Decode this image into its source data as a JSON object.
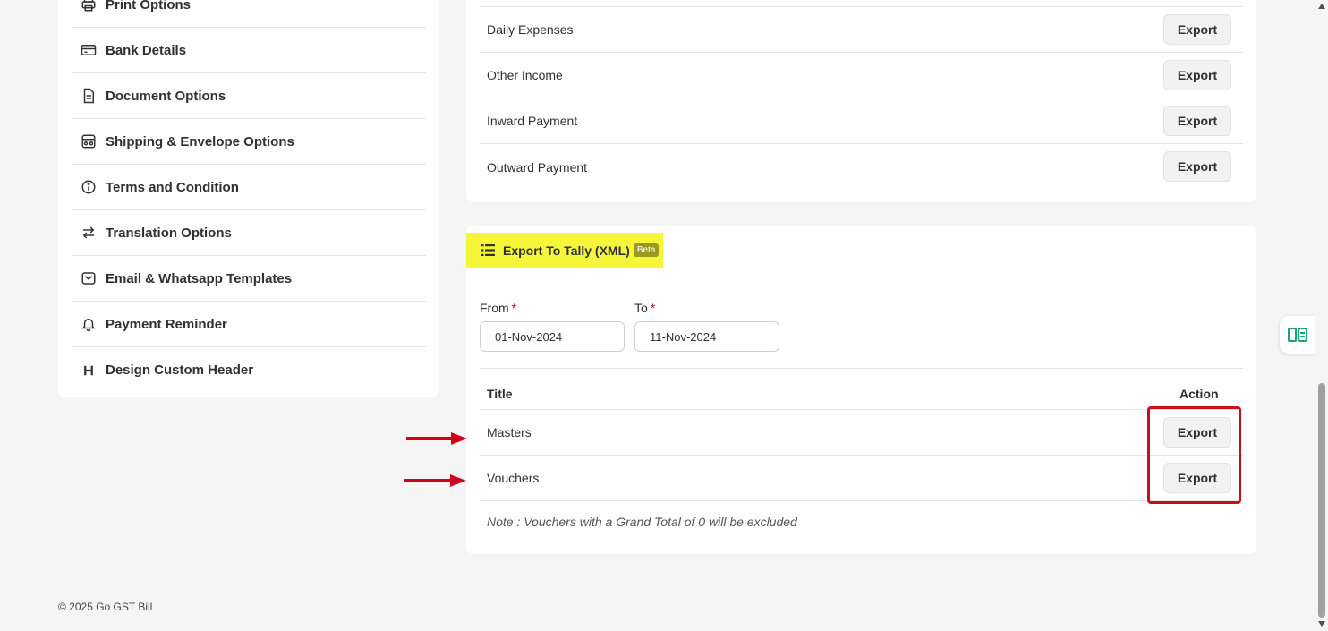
{
  "sidebar": {
    "items": [
      {
        "label": "Print Options",
        "icon": "printer-icon"
      },
      {
        "label": "Bank Details",
        "icon": "credit-card-icon"
      },
      {
        "label": "Document Options",
        "icon": "document-icon"
      },
      {
        "label": "Shipping & Envelope Options",
        "icon": "shipping-box-icon"
      },
      {
        "label": "Terms and Condition",
        "icon": "info-icon"
      },
      {
        "label": "Translation Options",
        "icon": "swap-arrows-icon"
      },
      {
        "label": "Email & Whatsapp Templates",
        "icon": "mail-icon"
      },
      {
        "label": "Payment Reminder",
        "icon": "bell-icon"
      },
      {
        "label": "Design Custom Header",
        "icon": "heading-icon"
      }
    ]
  },
  "export_list": {
    "rows": [
      {
        "title": "Daily Expenses",
        "action": "Export"
      },
      {
        "title": "Other Income",
        "action": "Export"
      },
      {
        "title": "Inward Payment",
        "action": "Export"
      },
      {
        "title": "Outward Payment",
        "action": "Export"
      }
    ]
  },
  "tally": {
    "title": "Export To Tally (XML)",
    "badge": "Beta",
    "from_label": "From",
    "to_label": "To",
    "required_mark": "*",
    "from_value": "01-Nov-2024",
    "to_value": "11-Nov-2024",
    "col_title": "Title",
    "col_action": "Action",
    "rows": [
      {
        "title": "Masters",
        "action": "Export"
      },
      {
        "title": "Vouchers",
        "action": "Export"
      }
    ],
    "note": "Note : Vouchers with a Grand Total of 0 will be excluded"
  },
  "footer": {
    "copyright": "© 2025 Go GST Bill"
  },
  "colors": {
    "highlight_yellow": "#f5f53a",
    "annotation_red": "#c8101d"
  }
}
